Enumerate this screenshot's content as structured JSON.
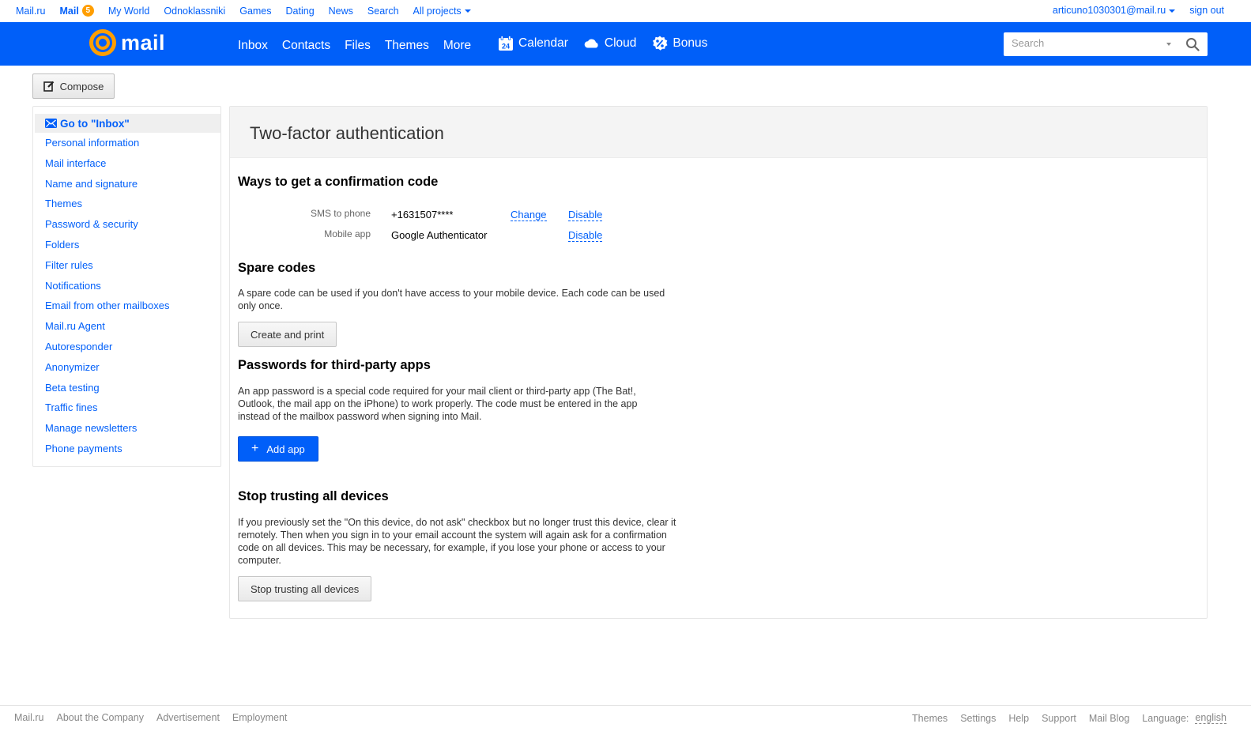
{
  "portal": {
    "items": [
      "Mail.ru",
      "Mail",
      "My World",
      "Odnoklassniki",
      "Games",
      "Dating",
      "News",
      "Search",
      "All projects"
    ],
    "mail_count": "5",
    "user": "articuno1030301@mail.ru",
    "signout": "sign out"
  },
  "header": {
    "logo": "mail",
    "nav": [
      "Inbox",
      "Contacts",
      "Files",
      "Themes",
      "More"
    ],
    "calendar": "Calendar",
    "calendar_day": "24",
    "cloud": "Cloud",
    "bonus": "Bonus",
    "search_placeholder": "Search"
  },
  "compose": "Compose",
  "sidebar": {
    "goto_inbox": "Go to \"Inbox\"",
    "items": [
      "Personal information",
      "Mail interface",
      "Name and signature",
      "Themes",
      "Password & security",
      "Folders",
      "Filter rules",
      "Notifications",
      "Email from other mailboxes",
      "Mail.ru Agent",
      "Autoresponder",
      "Anonymizer",
      "Beta testing",
      "Traffic fines",
      "Manage newsletters",
      "Phone payments"
    ]
  },
  "main": {
    "title": "Two-factor authentication",
    "ways": {
      "title": "Ways to get a confirmation code",
      "sms_label": "SMS to phone",
      "sms_value": "+1631507****",
      "change": "Change",
      "disable": "Disable",
      "app_label": "Mobile app",
      "app_value": "Google Authenticator",
      "app_disable": "Disable"
    },
    "spare": {
      "title": "Spare codes",
      "text": "A spare code can be used if you don't have access to your mobile device. Each code can be used only once.",
      "button": "Create and print"
    },
    "passwords": {
      "title": "Passwords for third-party apps",
      "text": "An app password is a special code required for your mail client or third-party app (The Bat!, Outlook, the mail app on the iPhone) to work properly. The code must be entered in the app instead of the mailbox password when signing into Mail.",
      "button": "Add app"
    },
    "trust": {
      "title": "Stop trusting all devices",
      "text": "If you previously set the \"On this device, do not ask\" checkbox but no longer trust this device, clear it remotely. Then when you sign in to your email account the system will again ask for a confirmation code on all devices. This may be necessary, for example, if you lose your phone or access to your computer.",
      "button": "Stop trusting all devices"
    }
  },
  "footer": {
    "left": [
      "Mail.ru",
      "About the Company",
      "Advertisement",
      "Employment"
    ],
    "right": [
      "Themes",
      "Settings",
      "Help",
      "Support",
      "Mail Blog"
    ],
    "language_label": "Language:",
    "language": "english"
  },
  "colors": {
    "brand_blue": "#005ff9",
    "accent_orange": "#ff9e00"
  }
}
